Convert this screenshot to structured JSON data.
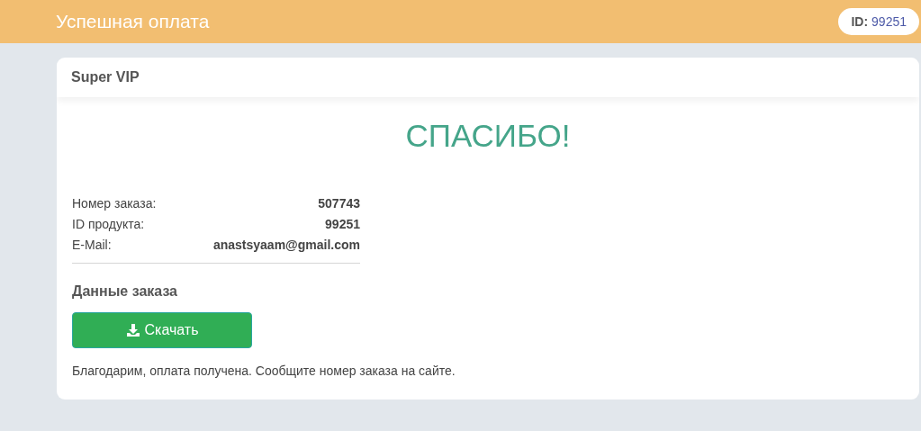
{
  "header": {
    "title": "Успешная оплата",
    "id_label": "ID:",
    "id_value": "99251"
  },
  "card": {
    "title": "Super VIP",
    "heading": "СПАСИБО!",
    "details": [
      {
        "label": "Номер заказа:",
        "value": "507743"
      },
      {
        "label": "ID продукта:",
        "value": "99251"
      },
      {
        "label": "E-Mail:",
        "value": "anastsyaam@gmail.com"
      }
    ],
    "section_title": "Данные заказа",
    "download_button": "Скачать",
    "note": "Благодарим, оплата получена. Сообщите номер заказа на сайте."
  }
}
